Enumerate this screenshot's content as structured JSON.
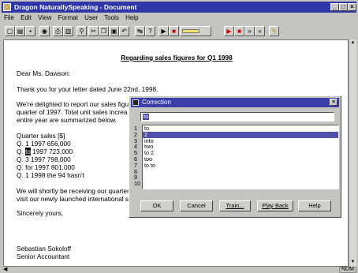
{
  "window": {
    "title": "Dragon NaturallySpeaking - Document",
    "controls": [
      "_",
      "□",
      "×"
    ]
  },
  "menu": [
    "File",
    "Edit",
    "View",
    "Format",
    "User",
    "Tools",
    "Help"
  ],
  "toolbar": {
    "icons": [
      "new-icon",
      "open-icon",
      "save-icon",
      "train-icon",
      "print-icon",
      "print-preview-icon",
      "find-icon",
      "cut-icon",
      "copy-icon",
      "paste-icon",
      "undo-icon",
      "correction-icon",
      "help-icon",
      "play-icon",
      "stop-icon",
      "microphone-level-icon",
      "play-icon-2",
      "stop-icon-2",
      "forward-icon",
      "rewind-icon",
      "record-icon"
    ]
  },
  "document": {
    "heading": "Regarding sales figures for Q1 1998",
    "greeting": "Dear Ms. Dawson:",
    "p1": "Thank you for your letter dated June 22nd, 1998.",
    "p2_l1": "We're delighted to report our sales figu",
    "p2_l2": "quarter of 1997.  Total unit sales increa",
    "p2_l3": "entire year are summarized below.",
    "sales_title": "Quarter sales [$]",
    "rows": [
      "Q. 1 1997 656,000",
      "Q. ",
      " 1997 723,000",
      "Q. 3 1997 798,000",
      "Q. for 1997 801,000",
      "Q. 1 1998 the 94 hasn't"
    ],
    "highlight": "to",
    "p3_l1": "We will shortly be receiving our quarter",
    "p3_l2": "visit our newly launched international s",
    "closing": "Sincerely yours,",
    "signer": "Sebastian Sokoloff",
    "signer_title": "Senior Accountant"
  },
  "status": {
    "num": "NUM"
  },
  "correction": {
    "title": "Correction",
    "input_value": "to",
    "numbers": [
      "1",
      "2",
      "3",
      "4",
      "5",
      "6",
      "7",
      "8",
      "9",
      "10"
    ],
    "items": [
      "to",
      "2",
      "into",
      "two",
      "to 2",
      "too",
      "to to",
      "",
      "",
      ""
    ],
    "selected_index": 1,
    "buttons": {
      "ok": "OK",
      "cancel": "Cancel",
      "train": "Train...",
      "playback": "Play Back",
      "help": "Help"
    }
  },
  "colors": {
    "titlebar": "#2e36a8",
    "selection": "#5050b0",
    "dialog_face": "#c4c4c0"
  }
}
